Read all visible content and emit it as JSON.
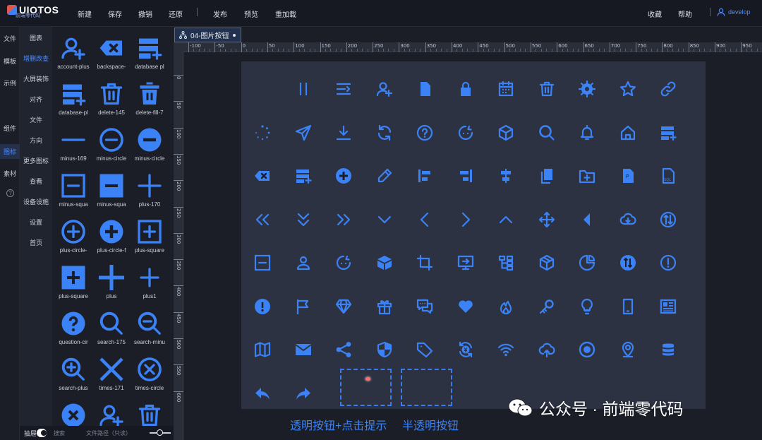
{
  "app": {
    "logo": "UIOTOS",
    "logo_sub": "前端零代码",
    "menu": [
      "新建",
      "保存",
      "撤销",
      "还原",
      "发布",
      "预览",
      "重加载"
    ],
    "right_menu": [
      "收藏",
      "帮助"
    ],
    "user": "develop"
  },
  "rail": {
    "items": [
      "文件",
      "模板",
      "示例",
      "组件",
      "图标",
      "素材"
    ],
    "active": "图标"
  },
  "categories": {
    "items": [
      "图表",
      "增删改查",
      "大屏装饰",
      "对齐",
      "文件",
      "方向",
      "更多图标",
      "查看",
      "设备设施",
      "设置",
      "首页"
    ],
    "active": "增删改查"
  },
  "icon_list": [
    {
      "label": "account-plus",
      "icon": "account-plus-icon"
    },
    {
      "label": "backspace-",
      "icon": "backspace-icon"
    },
    {
      "label": "database pl",
      "icon": "database-plus-icon"
    },
    {
      "label": "database-pl",
      "icon": "database-plus-icon"
    },
    {
      "label": "delete-145",
      "icon": "delete-icon"
    },
    {
      "label": "delete-fill-7",
      "icon": "delete-fill-icon"
    },
    {
      "label": "minus-169",
      "icon": "minus-icon"
    },
    {
      "label": "minus-circle",
      "icon": "minus-circle-icon"
    },
    {
      "label": "minus-circle",
      "icon": "minus-circle-fill-icon"
    },
    {
      "label": "minus-squa",
      "icon": "minus-square-icon"
    },
    {
      "label": "minus-squa",
      "icon": "minus-square-fill-icon"
    },
    {
      "label": "plus-170",
      "icon": "plus-icon"
    },
    {
      "label": "plus-circle-",
      "icon": "plus-circle-icon"
    },
    {
      "label": "plus-circle-f",
      "icon": "plus-circle-fill-icon"
    },
    {
      "label": "plus-square",
      "icon": "plus-square-icon"
    },
    {
      "label": "plus-square",
      "icon": "plus-square-fill-icon"
    },
    {
      "label": "plus",
      "icon": "plus-large-icon"
    },
    {
      "label": "plus1",
      "icon": "plus-small-icon"
    },
    {
      "label": "question-cir",
      "icon": "question-circle-fill-icon"
    },
    {
      "label": "search-175",
      "icon": "search-icon"
    },
    {
      "label": "search-minu",
      "icon": "search-minus-icon"
    },
    {
      "label": "search-plus",
      "icon": "search-plus-icon"
    },
    {
      "label": "times-171",
      "icon": "times-icon"
    },
    {
      "label": "times-circle",
      "icon": "times-circle-icon"
    },
    {
      "label": "",
      "icon": "times-circle-fill-icon"
    },
    {
      "label": "",
      "icon": "account-plus-icon"
    },
    {
      "label": "",
      "icon": "delete-icon"
    }
  ],
  "bottombar": {
    "toggle_label": "抽屉",
    "search_placeholder": "搜索",
    "path_placeholder": "文件路径（只读）"
  },
  "editor": {
    "tab_title": "04-图片按钮",
    "ruler_h": [
      "-100",
      "-50",
      "0",
      "50",
      "100",
      "150",
      "200",
      "250",
      "300",
      "350",
      "400",
      "450",
      "500",
      "550",
      "600",
      "650",
      "700",
      "750",
      "800",
      "850",
      "900",
      "950"
    ],
    "ruler_v": [
      "0",
      "50",
      "100",
      "150",
      "200",
      "250",
      "300",
      "350",
      "400",
      "450",
      "500",
      "550",
      "600"
    ]
  },
  "canvas_icons": [
    [
      "pause-icon",
      "indent-icon",
      "account-plus-icon",
      "file-icon",
      "lock-icon",
      "calendar-icon",
      "delete-icon",
      "gear-icon",
      "star-icon",
      "link-icon"
    ],
    [
      "loading-icon",
      "send-icon",
      "download-icon",
      "refresh-icon",
      "question-circle-icon",
      "smile-icon",
      "cube-icon",
      "search-icon",
      "bell-icon",
      "home-icon",
      "database-plus-icon"
    ],
    [
      "backspace-icon",
      "database-plus-icon",
      "plus-circle-fill-icon",
      "pencil-icon",
      "align-left-icon",
      "align-right-icon",
      "align-center-icon",
      "copy-icon",
      "folder-plus-icon",
      "file-p-icon",
      "file-sql-icon"
    ],
    [
      "chevrons-left-icon",
      "chevrons-down-icon",
      "chevrons-right-icon",
      "chevron-down-icon",
      "chevron-left-icon",
      "chevron-right-icon",
      "chevron-up-icon",
      "move-icon",
      "caret-left-icon",
      "cloud-download-icon",
      "sort-circle-icon"
    ],
    [
      "minus-square-icon",
      "user-icon",
      "smile-icon",
      "box-icon",
      "crop-icon",
      "screen-share-icon",
      "network-icon",
      "cube-outline-icon",
      "pie-icon",
      "sort-circle-fill-icon",
      "alert-circle-icon"
    ],
    [
      "alert-circle-fill-icon",
      "flag-icon",
      "diamond-icon",
      "gift-icon",
      "chat-icon",
      "heart-icon",
      "fire-icon",
      "key-icon",
      "bulb-icon",
      "mobile-icon",
      "news-icon"
    ],
    [
      "map-icon",
      "mail-icon",
      "share-icon",
      "shield-icon",
      "tag-icon",
      "yen-cycle-icon",
      "wifi-icon",
      "cloud-upload-icon",
      "record-icon",
      "location-icon",
      "database-icon"
    ],
    [
      "reply-icon",
      "forward-icon"
    ]
  ],
  "captions": [
    "透明按钮+点击提示",
    "半透明按钮"
  ],
  "watermark": "公众号 · 前端零代码",
  "colors": {
    "accent": "#3b82f6",
    "canvas": "#2d3242",
    "panel": "#1b1e27"
  }
}
